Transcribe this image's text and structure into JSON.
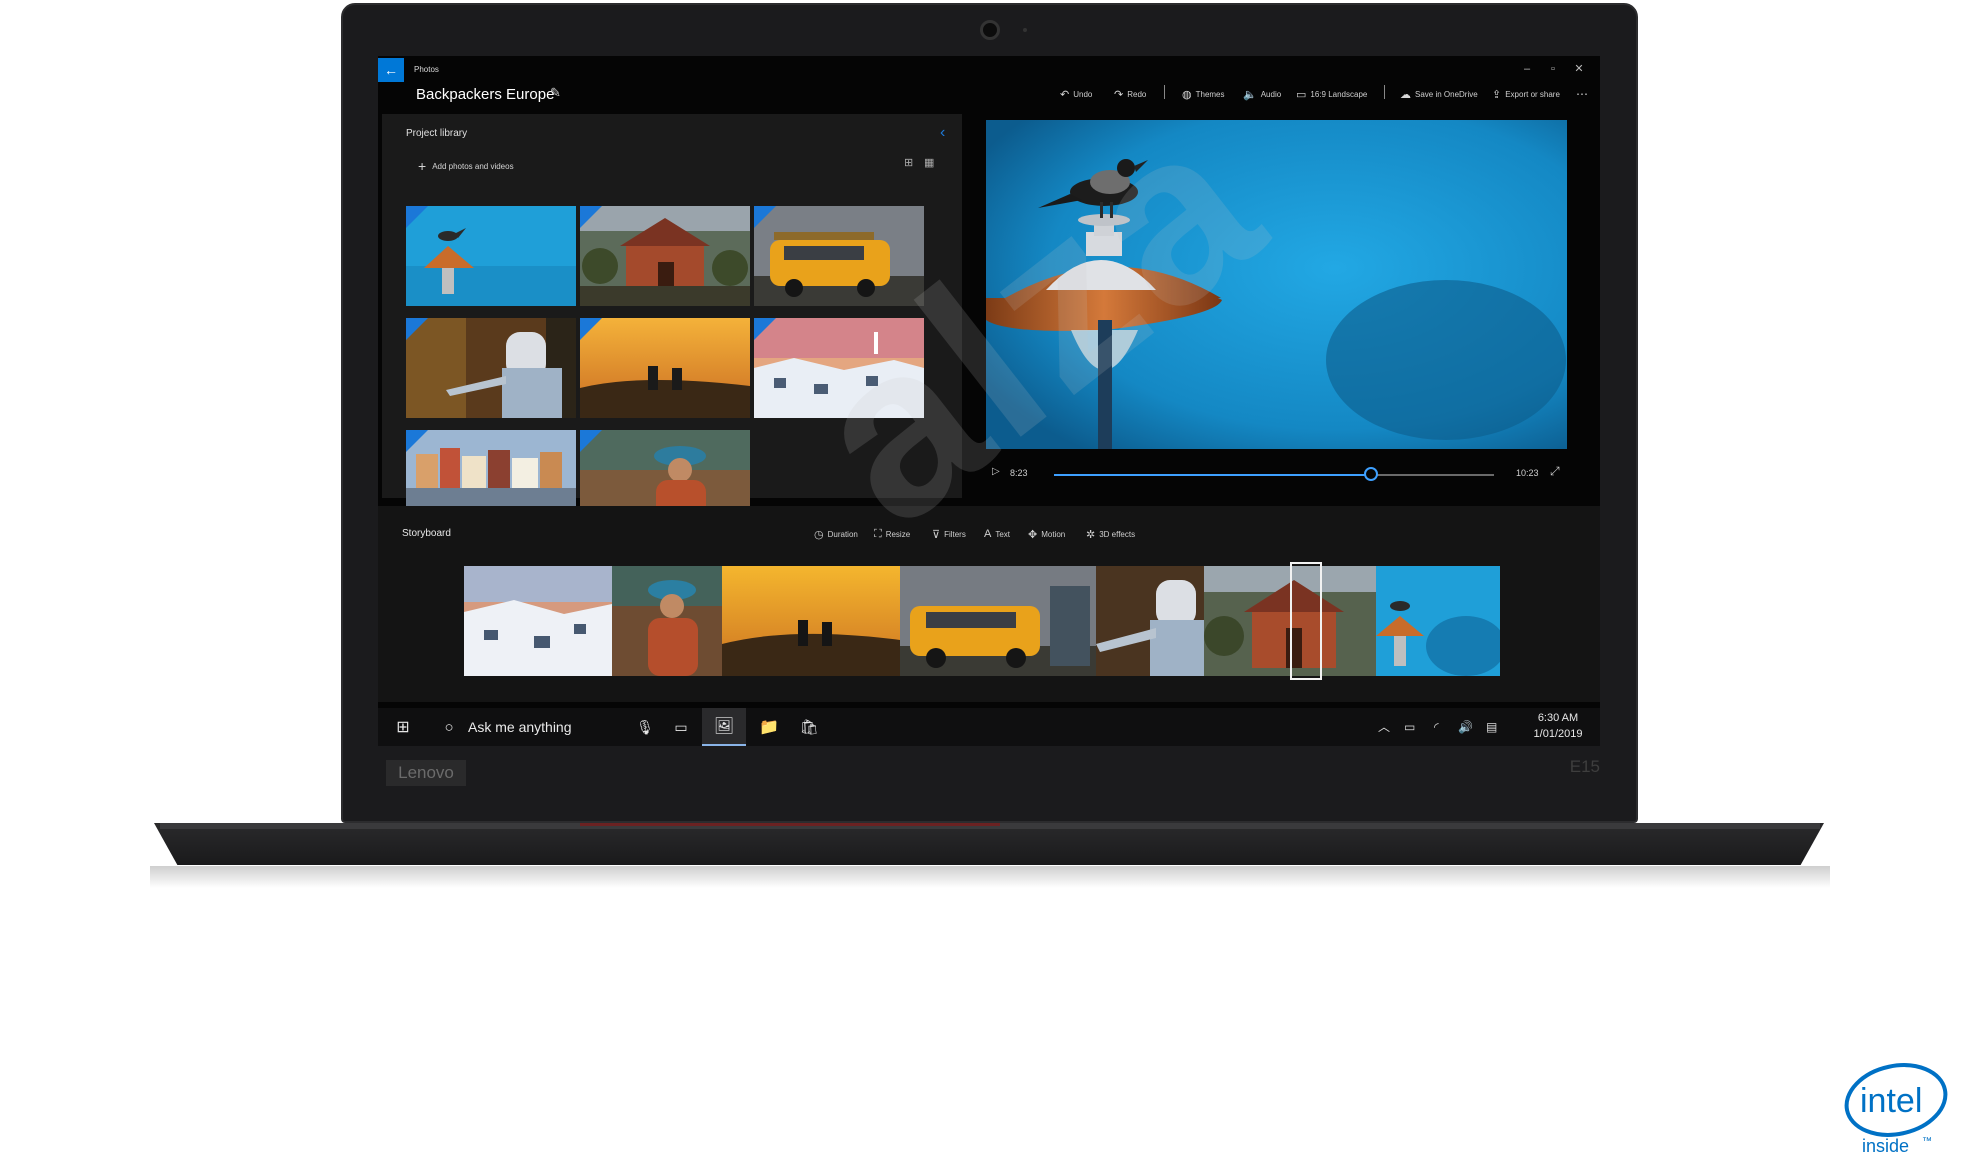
{
  "device": {
    "brand": "Lenovo",
    "model": "E15"
  },
  "window": {
    "app_name": "Photos",
    "project_title": "Backpackers Europe",
    "controls": {
      "minimize": "–",
      "maximize": "▫",
      "close": "✕"
    }
  },
  "toolbar": {
    "undo": "Undo",
    "redo": "Redo",
    "themes": "Themes",
    "audio": "Audio",
    "aspect": "16:9 Landscape",
    "save_onedrive": "Save in OneDrive",
    "export": "Export or share",
    "more": "⋯"
  },
  "library": {
    "title": "Project library",
    "add_label": "Add photos and videos",
    "thumbnails": [
      "bird on lamp",
      "house",
      "yellow van",
      "hiker hoodie",
      "sunset hikers",
      "white village",
      "lakeside town",
      "hat backpacker"
    ]
  },
  "player": {
    "current_time": "8:23",
    "total_time": "10:23",
    "progress": 0.72
  },
  "storyboard": {
    "title": "Storyboard",
    "tools": [
      "Duration",
      "Resize",
      "Filters",
      "Text",
      "Motion",
      "3D effects"
    ]
  },
  "taskbar": {
    "search_placeholder": "Ask me anything",
    "time": "6:30 AM",
    "date": "1/01/2019"
  },
  "watermark": "alza",
  "badge": {
    "brand": "intel",
    "tagline": "inside",
    "tm": "™"
  },
  "colors": {
    "accent": "#0078d7",
    "sky": "#1a9ad8",
    "bezel": "#1b1b1d"
  }
}
